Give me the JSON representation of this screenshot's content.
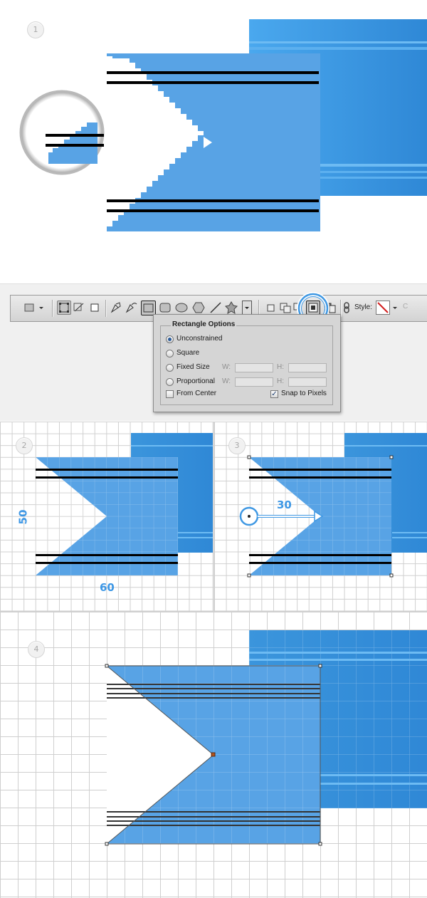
{
  "steps": [
    "1",
    "2",
    "3",
    "4"
  ],
  "rectangle_options": {
    "title": "Rectangle Options",
    "options": [
      {
        "label": "Unconstrained",
        "selected": true
      },
      {
        "label": "Square",
        "selected": false
      },
      {
        "label": "Fixed Size",
        "selected": false
      },
      {
        "label": "Proportional",
        "selected": false
      }
    ],
    "fixed_w_label": "W:",
    "fixed_h_label": "H:",
    "prop_w_label": "W:",
    "prop_h_label": "H:",
    "from_center": {
      "label": "From Center",
      "checked": false
    },
    "snap_to_pixels": {
      "label": "Snap to Pixels",
      "checked": true
    }
  },
  "toolbar": {
    "style_label": "Style:",
    "icons": [
      "rectangle-tool-preset-icon",
      "dropdown-arrow-icon",
      "shape-layers-icon",
      "paths-icon",
      "fill-pixels-icon",
      "pen-icon",
      "freeform-pen-icon",
      "rectangle-icon",
      "rounded-rectangle-icon",
      "ellipse-icon",
      "polygon-icon",
      "line-icon",
      "custom-shape-icon",
      "geometry-options-icon",
      "new-shape-layer-icon",
      "add-to-shape-icon",
      "subtract-from-shape-icon",
      "intersect-shape-icon",
      "exclude-overlap-icon",
      "link-icon",
      "style-none-icon"
    ]
  },
  "dimensions": {
    "height": "50",
    "width": "60",
    "move": "30"
  },
  "colors": {
    "ribbon_blue": "#58a3e5",
    "ribbon_dark": "#3b95dc",
    "stripe_light": "#7cc0f0",
    "highlight_ring": "#3f98e3",
    "anchor_orange": "#b4541d"
  }
}
